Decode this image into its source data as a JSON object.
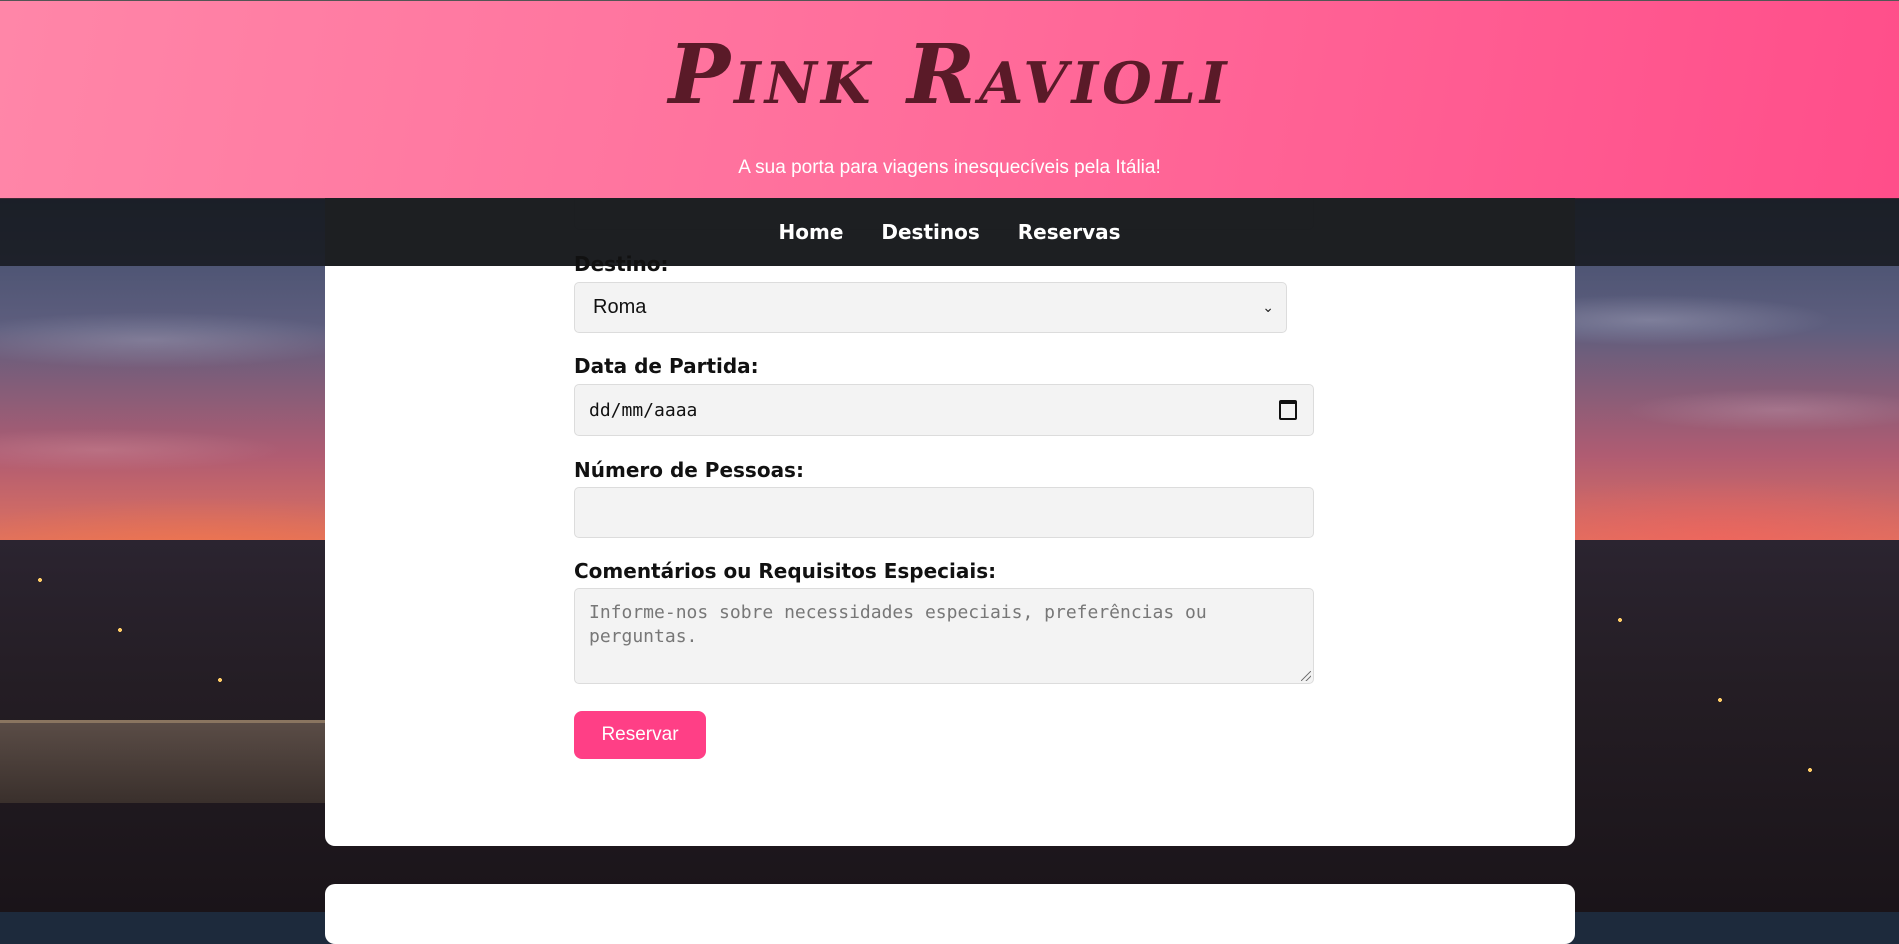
{
  "header": {
    "brand": "Pink Ravioli",
    "tagline": "A sua porta para viagens inesquecíveis pela Itália!"
  },
  "nav": {
    "items": [
      {
        "label": "Home"
      },
      {
        "label": "Destinos"
      },
      {
        "label": "Reservas"
      }
    ]
  },
  "form": {
    "destino": {
      "label": "Destino:",
      "selected": "Roma"
    },
    "data": {
      "label": "Data de Partida:",
      "placeholder": "dd/mm/aaaa"
    },
    "pessoas": {
      "label": "Número de Pessoas:",
      "value": ""
    },
    "comentarios": {
      "label": "Comentários ou Requisitos Especiais:",
      "placeholder": "Informe-nos sobre necessidades especiais, preferências ou perguntas."
    },
    "submit_label": "Reservar"
  },
  "colors": {
    "header_gradient_start": "#ff86a8",
    "header_gradient_end": "#ff4e8a",
    "brand_text": "#5a1a28",
    "button": "#ff3f86",
    "navbar": "#14161a"
  },
  "icons": {
    "select_chevron": "chevron-down-icon",
    "date_picker": "calendar-icon"
  }
}
